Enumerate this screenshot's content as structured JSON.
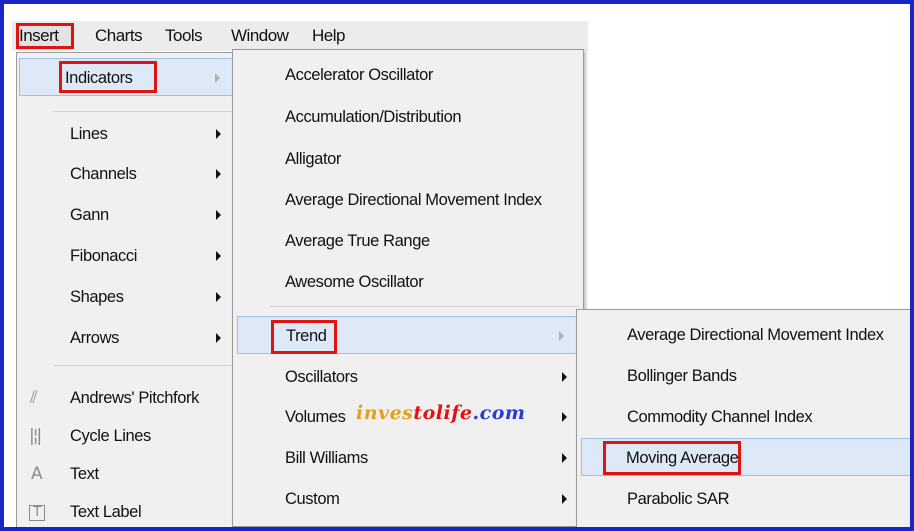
{
  "menubar": {
    "items": [
      {
        "label": "Insert"
      },
      {
        "label": "Charts"
      },
      {
        "label": "Tools"
      },
      {
        "label": "Window"
      },
      {
        "label": "Help"
      }
    ]
  },
  "insert_menu": {
    "indicators": "Indicators",
    "items": [
      {
        "label": "Lines"
      },
      {
        "label": "Channels"
      },
      {
        "label": "Gann"
      },
      {
        "label": "Fibonacci"
      },
      {
        "label": "Shapes"
      },
      {
        "label": "Arrows"
      },
      {
        "label": "Andrews' Pitchfork"
      },
      {
        "label": "Cycle Lines"
      },
      {
        "label": "Text"
      },
      {
        "label": "Text Label"
      }
    ]
  },
  "indicators_menu": {
    "items": [
      {
        "label": "Accelerator Oscillator"
      },
      {
        "label": "Accumulation/Distribution"
      },
      {
        "label": "Alligator"
      },
      {
        "label": "Average Directional Movement Index"
      },
      {
        "label": "Average True Range"
      },
      {
        "label": "Awesome Oscillator"
      },
      {
        "label": "Trend"
      },
      {
        "label": "Oscillators"
      },
      {
        "label": "Volumes"
      },
      {
        "label": "Bill Williams"
      },
      {
        "label": "Custom"
      }
    ]
  },
  "trend_menu": {
    "items": [
      {
        "label": "Average Directional Movement Index"
      },
      {
        "label": "Bollinger Bands"
      },
      {
        "label": "Commodity Channel Index"
      },
      {
        "label": "Moving Average"
      },
      {
        "label": "Parabolic SAR"
      }
    ]
  },
  "watermark": {
    "part1": "inves",
    "part2": "tolife",
    "part3": ".com"
  },
  "colors": {
    "highlight_box": "#e01313",
    "frame_border": "#1a25c8",
    "selected_bg": "#dde9f7"
  }
}
